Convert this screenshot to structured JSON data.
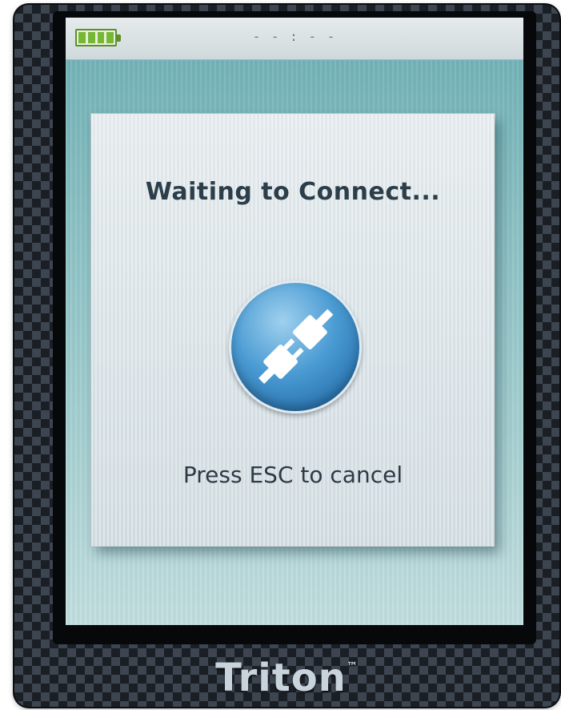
{
  "status_bar": {
    "battery_icon": "battery-full-icon",
    "battery_level": 1.0,
    "time": "- - : - -"
  },
  "dialog": {
    "title": "Waiting to Connect...",
    "icon": "plug-connect-icon",
    "hint": "Press ESC to cancel"
  },
  "device": {
    "brand": "Triton",
    "trademark": "™"
  },
  "colors": {
    "screen_bg": "#8ec3c6",
    "dialog_bg": "#dde6ea",
    "icon_blue": "#2a74b0",
    "battery_green": "#77b832",
    "text_dark": "#2c3e4a"
  }
}
